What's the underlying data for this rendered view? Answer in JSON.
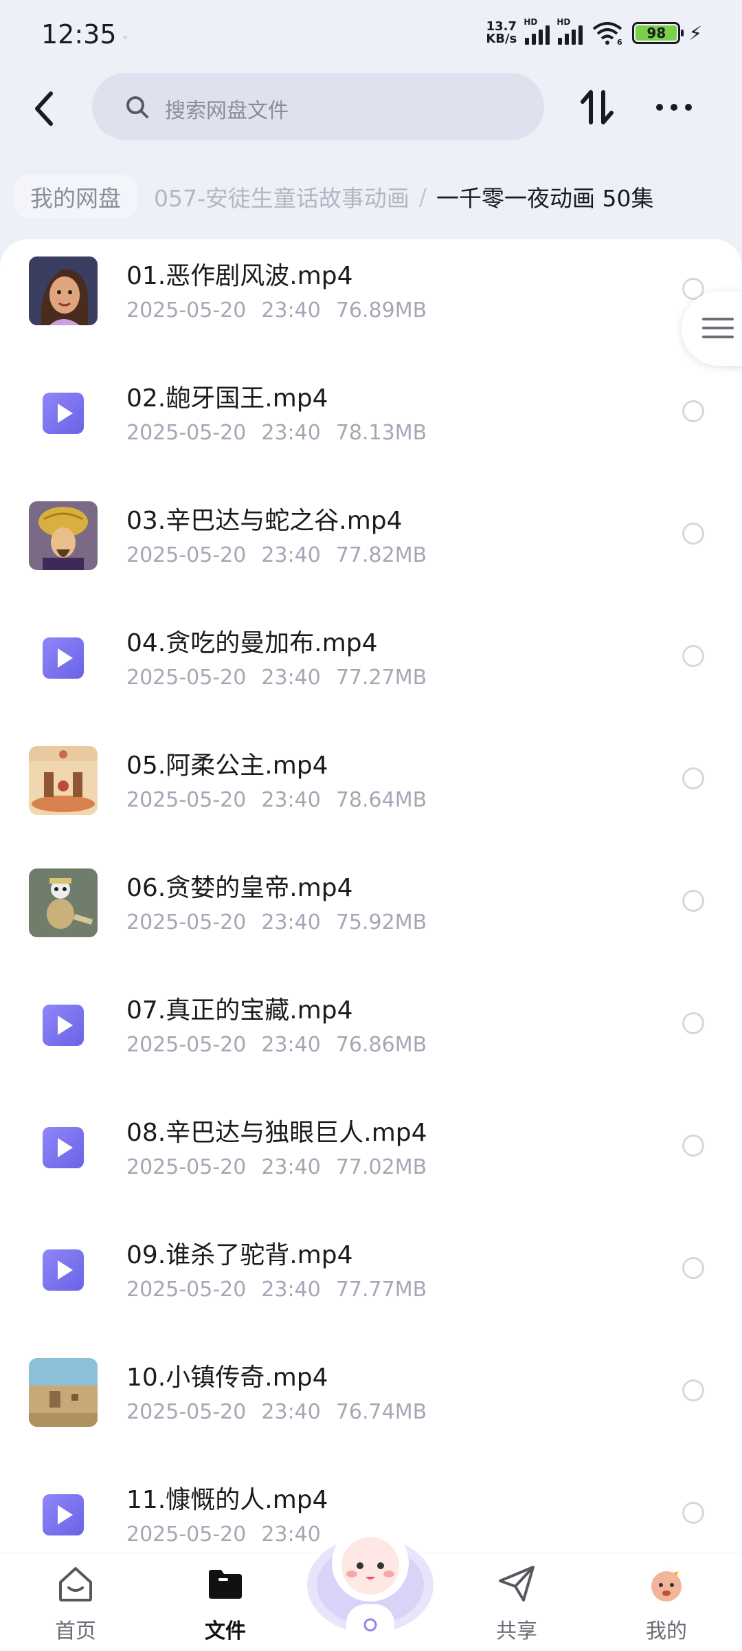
{
  "status_bar": {
    "time": "12:35",
    "net_speed_value": "13.7",
    "net_speed_unit": "KB/s",
    "hd1": "HD",
    "hd2": "HD",
    "wifi_badge": "6",
    "battery": "98"
  },
  "search": {
    "placeholder": "搜索网盘文件"
  },
  "breadcrumb": {
    "root": "我的网盘",
    "middle": "057-安徒生童话故事动画",
    "separator": "/",
    "current": "一千零一夜动画 50集"
  },
  "files": [
    {
      "name": "01.恶作剧风波.mp4",
      "date": "2025-05-20",
      "time": "23:40",
      "size": "76.89MB",
      "thumb": "thumb-woman"
    },
    {
      "name": "02.龅牙国王.mp4",
      "date": "2025-05-20",
      "time": "23:40",
      "size": "78.13MB",
      "thumb": "video-icon"
    },
    {
      "name": "03.辛巴达与蛇之谷.mp4",
      "date": "2025-05-20",
      "time": "23:40",
      "size": "77.82MB",
      "thumb": "thumb-turban"
    },
    {
      "name": "04.贪吃的曼加布.mp4",
      "date": "2025-05-20",
      "time": "23:40",
      "size": "77.27MB",
      "thumb": "video-icon"
    },
    {
      "name": "05.阿柔公主.mp4",
      "date": "2025-05-20",
      "time": "23:40",
      "size": "78.64MB",
      "thumb": "thumb-palace"
    },
    {
      "name": "06.贪婪的皇帝.mp4",
      "date": "2025-05-20",
      "time": "23:40",
      "size": "75.92MB",
      "thumb": "thumb-emperor"
    },
    {
      "name": "07.真正的宝藏.mp4",
      "date": "2025-05-20",
      "time": "23:40",
      "size": "76.86MB",
      "thumb": "video-icon"
    },
    {
      "name": "08.辛巴达与独眼巨人.mp4",
      "date": "2025-05-20",
      "time": "23:40",
      "size": "77.02MB",
      "thumb": "video-icon"
    },
    {
      "name": "09.谁杀了驼背.mp4",
      "date": "2025-05-20",
      "time": "23:40",
      "size": "77.77MB",
      "thumb": "video-icon"
    },
    {
      "name": "10.小镇传奇.mp4",
      "date": "2025-05-20",
      "time": "23:40",
      "size": "76.74MB",
      "thumb": "thumb-town"
    },
    {
      "name": "11.慷慨的人.mp4",
      "date": "2025-05-20",
      "time": "23:40",
      "size": "",
      "thumb": "video-icon"
    }
  ],
  "nav": {
    "home": "首页",
    "files": "文件",
    "share": "共享",
    "mine": "我的"
  },
  "colors": {
    "accent": "#6a63e6",
    "background": "#eef0f8",
    "battery": "#7bd04a"
  }
}
